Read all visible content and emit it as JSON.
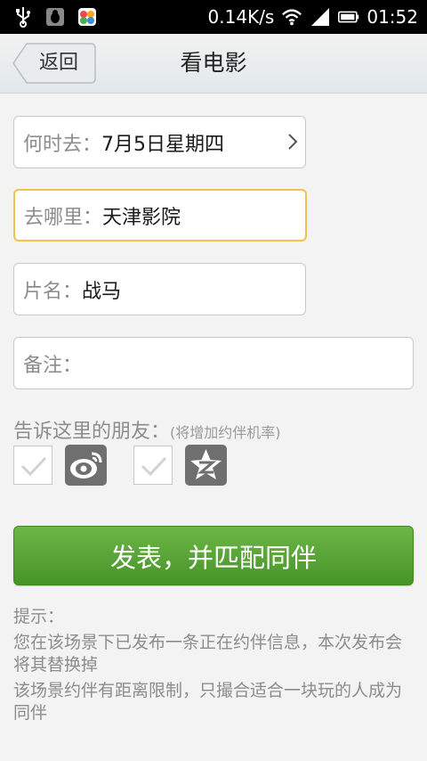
{
  "statusbar": {
    "net_speed": "0.14K/s",
    "time": "01:52",
    "icons": [
      "usb-icon",
      "debug-bug-icon",
      "app-notification-icon",
      "wifi-icon",
      "signal-icon",
      "battery-icon"
    ]
  },
  "header": {
    "back_label": "返回",
    "title": "看电影"
  },
  "form": {
    "when": {
      "label": "何时去：",
      "value": "7月5日星期四"
    },
    "where": {
      "label": "去哪里：",
      "value": "天津影院"
    },
    "movie": {
      "label": "片名：",
      "value": "战马"
    },
    "note": {
      "label": "备注：",
      "value": ""
    }
  },
  "share": {
    "label": "告诉这里的朋友：",
    "hint": "(将增加约伴机率)",
    "targets": [
      {
        "icon": "sina-weibo-icon",
        "checked": false
      },
      {
        "icon": "qzone-icon",
        "checked": false
      }
    ]
  },
  "publish_label": "发表，并匹配同伴",
  "tips": {
    "title": "提示：",
    "line1": "您在该场景下已发布一条正在约伴信息，本次发布会将其替换掉",
    "line2": "该场景约伴有距离限制，只撮合适合一块玩的人成为同伴"
  },
  "colors": {
    "accent_green": "#4fa02e",
    "active_border": "#f3c24a",
    "hint_gray": "#8c8c8c"
  }
}
